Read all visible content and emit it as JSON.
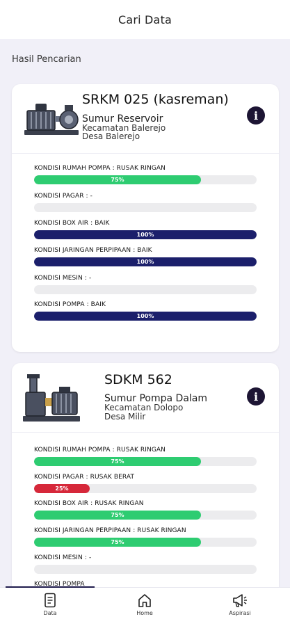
{
  "header": {
    "title": "Cari Data"
  },
  "section": {
    "label": "Hasil Pencarian"
  },
  "results": [
    {
      "name": "SRKM 025 (kasreman)",
      "type": "Sumur Reservoir",
      "kecamatan": "Kecamatan Balerejo",
      "desa": "Desa Balerejo",
      "conditions": [
        {
          "label": "KONDISI RUMAH POMPA : RUSAK RINGAN",
          "percent": 75,
          "percent_label": "75%",
          "status": "rusak-ringan"
        },
        {
          "label": "KONDISI PAGAR : -",
          "percent": 0,
          "percent_label": "",
          "status": "none"
        },
        {
          "label": "KONDISI BOX AIR : BAIK",
          "percent": 100,
          "percent_label": "100%",
          "status": "baik"
        },
        {
          "label": "KONDISI JARINGAN PERPIPAAN : BAIK",
          "percent": 100,
          "percent_label": "100%",
          "status": "baik"
        },
        {
          "label": "KONDISI MESIN : -",
          "percent": 0,
          "percent_label": "",
          "status": "none"
        },
        {
          "label": "KONDISI POMPA : BAIK",
          "percent": 100,
          "percent_label": "100%",
          "status": "baik"
        }
      ]
    },
    {
      "name": "SDKM 562",
      "type": "Sumur Pompa Dalam",
      "kecamatan": "Kecamatan Dolopo",
      "desa": "Desa Milir",
      "conditions": [
        {
          "label": "KONDISI RUMAH POMPA : RUSAK RINGAN",
          "percent": 75,
          "percent_label": "75%",
          "status": "rusak-ringan"
        },
        {
          "label": "KONDISI PAGAR : RUSAK BERAT",
          "percent": 25,
          "percent_label": "25%",
          "status": "rusak-berat"
        },
        {
          "label": "KONDISI BOX AIR : RUSAK RINGAN",
          "percent": 75,
          "percent_label": "75%",
          "status": "rusak-ringan"
        },
        {
          "label": "KONDISI JARINGAN PERPIPAAN : RUSAK RINGAN",
          "percent": 75,
          "percent_label": "75%",
          "status": "rusak-ringan"
        },
        {
          "label": "KONDISI MESIN : -",
          "percent": 0,
          "percent_label": "",
          "status": "none"
        },
        {
          "label": "KONDISI POMPA",
          "percent": 0,
          "percent_label": "",
          "status": "none"
        }
      ]
    }
  ],
  "colors": {
    "baik": "#1b1f6b",
    "rusak-ringan": "#2ecc71",
    "rusak-berat": "#d6283a",
    "info": "#1d1534"
  },
  "nav": [
    {
      "label": "Data",
      "icon": "document-icon",
      "active": true
    },
    {
      "label": "Home",
      "icon": "home-icon",
      "active": false
    },
    {
      "label": "Aspirasi",
      "icon": "megaphone-icon",
      "active": false
    }
  ]
}
